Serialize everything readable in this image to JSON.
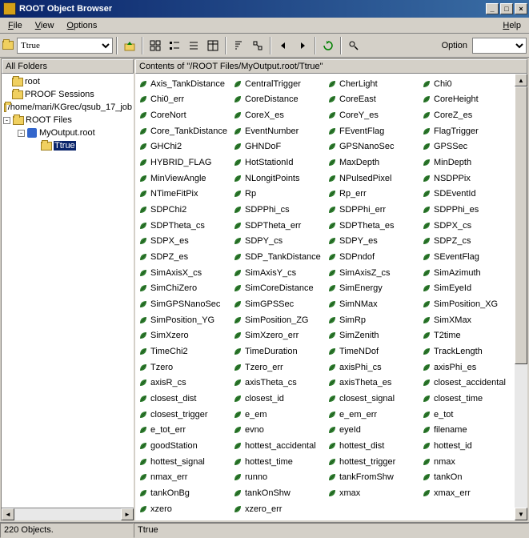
{
  "window": {
    "title": "ROOT Object Browser"
  },
  "menu": {
    "file": "File",
    "view": "View",
    "options": "Options",
    "help": "Help"
  },
  "toolbar": {
    "path": "Ttrue",
    "option_label": "Option",
    "option_value": ""
  },
  "left": {
    "header": "All Folders",
    "tree": [
      {
        "label": "root",
        "depth": 0,
        "type": "folder"
      },
      {
        "label": "PROOF Sessions",
        "depth": 0,
        "type": "folder"
      },
      {
        "label": "/home/mari/KGrec/qsub_17_job",
        "depth": 0,
        "type": "folder"
      },
      {
        "label": "ROOT Files",
        "depth": 0,
        "type": "folder",
        "exp": "-"
      },
      {
        "label": "MyOutput.root",
        "depth": 1,
        "type": "rootfile",
        "exp": "-"
      },
      {
        "label": "Ttrue",
        "depth": 2,
        "type": "folder",
        "selected": true
      }
    ]
  },
  "right": {
    "header": "Contents of \"/ROOT Files/MyOutput.root/Ttrue\"",
    "items": [
      "Axis_TankDistance",
      "CentralTrigger",
      "CherLight",
      "Chi0",
      "Chi0_err",
      "CoreDistance",
      "CoreEast",
      "CoreHeight",
      "CoreNort",
      "CoreX_es",
      "CoreY_es",
      "CoreZ_es",
      "Core_TankDistance",
      "EventNumber",
      "FEventFlag",
      "FlagTrigger",
      "GHChi2",
      "GHNDoF",
      "GPSNanoSec",
      "GPSSec",
      "HYBRID_FLAG",
      "HotStationId",
      "MaxDepth",
      "MinDepth",
      "MinViewAngle",
      "NLongitPoints",
      "NPulsedPixel",
      "NSDPPix",
      "NTimeFitPix",
      "Rp",
      "Rp_err",
      "SDEventId",
      "SDPChi2",
      "SDPPhi_cs",
      "SDPPhi_err",
      "SDPPhi_es",
      "SDPTheta_cs",
      "SDPTheta_err",
      "SDPTheta_es",
      "SDPX_cs",
      "SDPX_es",
      "SDPY_cs",
      "SDPY_es",
      "SDPZ_cs",
      "SDPZ_es",
      "SDP_TankDistance",
      "SDPndof",
      "SEventFlag",
      "SimAxisX_cs",
      "SimAxisY_cs",
      "SimAxisZ_cs",
      "SimAzimuth",
      "SimChiZero",
      "SimCoreDistance",
      "SimEnergy",
      "SimEyeId",
      "SimGPSNanoSec",
      "SimGPSSec",
      "SimNMax",
      "SimPosition_XG",
      "SimPosition_YG",
      "SimPosition_ZG",
      "SimRp",
      "SimXMax",
      "SimXzero",
      "SimXzero_err",
      "SimZenith",
      "T2time",
      "TimeChi2",
      "TimeDuration",
      "TimeNDof",
      "TrackLength",
      "Tzero",
      "Tzero_err",
      "axisPhi_cs",
      "axisPhi_es",
      "axisR_cs",
      "axisTheta_cs",
      "axisTheta_es",
      "closest_accidental",
      "closest_dist",
      "closest_id",
      "closest_signal",
      "closest_time",
      "closest_trigger",
      "e_em",
      "e_em_err",
      "e_tot",
      "e_tot_err",
      "evno",
      "eyeId",
      "filename",
      "goodStation",
      "hottest_accidental",
      "hottest_dist",
      "hottest_id",
      "hottest_signal",
      "hottest_time",
      "hottest_trigger",
      "nmax",
      "nmax_err",
      "runno",
      "tankFromShw",
      "tankOn",
      "tankOnBg",
      "tankOnShw",
      "xmax",
      "xmax_err",
      "xzero",
      "xzero_err"
    ]
  },
  "status": {
    "left": "220 Objects.",
    "right": "Ttrue"
  }
}
